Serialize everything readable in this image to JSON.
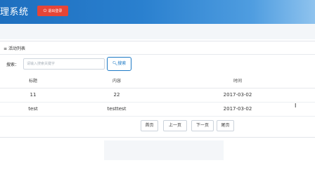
{
  "header": {
    "app_title": "理系统",
    "logout_icon": "power-icon",
    "logout_label": "退出登录"
  },
  "panel": {
    "title_icon": "≡",
    "title": "活动列表",
    "search_label": "搜索：",
    "search_placeholder": "请输入搜索关键字",
    "search_button_icon": "🔍︎",
    "search_button_label": "搜索"
  },
  "table": {
    "columns": [
      "标题",
      "内容",
      "时间"
    ],
    "rows": [
      [
        "11",
        "22",
        "2017-03-02"
      ],
      [
        "test",
        "testtest",
        "2017-03-02"
      ]
    ]
  },
  "pagination": {
    "first": "首页",
    "prev": "上一页",
    "next": "下一页",
    "last": "尾页"
  },
  "colors": {
    "header_blue": "#1e6fbf",
    "logout_red": "#e64537",
    "accent_blue": "#1f7bc6"
  }
}
